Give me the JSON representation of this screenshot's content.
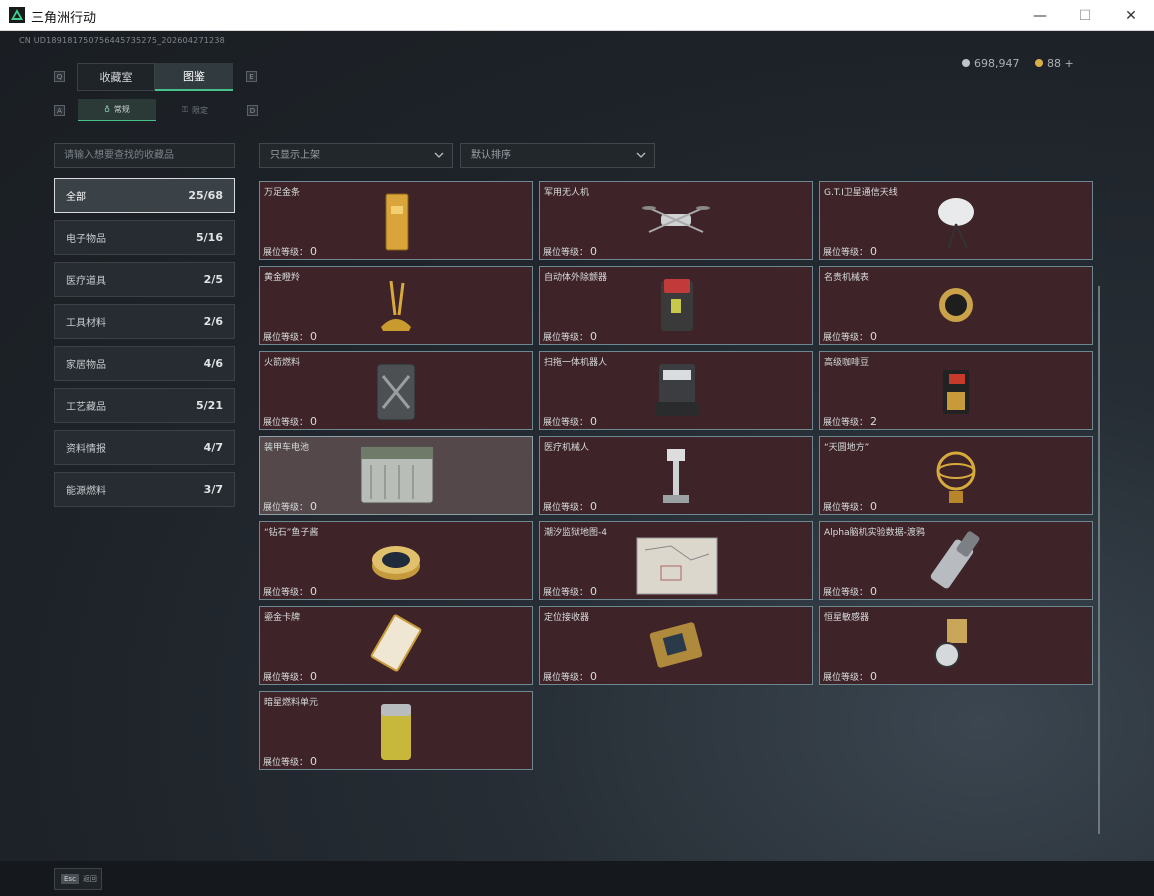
{
  "window": {
    "title": "三角洲行动",
    "minimize": "—",
    "maximize": "☐",
    "close": "✕"
  },
  "header": {
    "uid": "CN UD189181750756445735275_202604271238",
    "currency": [
      {
        "icon": "silver-coin-icon",
        "value": "698,947"
      },
      {
        "icon": "gold-coin-icon",
        "value": "88 +"
      }
    ]
  },
  "tabs": [
    {
      "label": "收藏室",
      "key_left": "Q",
      "active": false
    },
    {
      "label": "图鉴",
      "key_right": "E",
      "active": true
    }
  ],
  "subtabs": [
    {
      "label": "常规",
      "key_left": "A",
      "active": true
    },
    {
      "label": "限定",
      "key_right": "D",
      "active": false
    }
  ],
  "search": {
    "placeholder": "请输入想要查找的收藏品"
  },
  "filters": {
    "shelf_filter": "只显示上架",
    "sort": "默认排序"
  },
  "categories": [
    {
      "label": "全部",
      "count": "25/68",
      "active": true
    },
    {
      "label": "电子物品",
      "count": "5/16"
    },
    {
      "label": "医疗道具",
      "count": "2/5"
    },
    {
      "label": "工具材料",
      "count": "2/6"
    },
    {
      "label": "家居物品",
      "count": "4/6"
    },
    {
      "label": "工艺藏品",
      "count": "5/21"
    },
    {
      "label": "资料情报",
      "count": "4/7"
    },
    {
      "label": "能源燃料",
      "count": "3/7"
    }
  ],
  "level_label": "展位等级：",
  "items": [
    {
      "name": "",
      "level": "0",
      "icon": "dark-panel-icon"
    },
    {
      "name": "",
      "level": "0",
      "icon": "circuit-case-icon"
    },
    {
      "name": "",
      "level": "0",
      "icon": "bottle-icon"
    },
    {
      "name": "万足金条",
      "level": "0",
      "icon": "gold-bar-icon"
    },
    {
      "name": "军用无人机",
      "level": "0",
      "icon": "drone-icon"
    },
    {
      "name": "G.T.I卫星通信天线",
      "level": "0",
      "icon": "satellite-dish-icon"
    },
    {
      "name": "黄金瞪羚",
      "level": "0",
      "icon": "golden-gazelle-icon"
    },
    {
      "name": "自动体外除颤器",
      "level": "0",
      "icon": "defibrillator-icon"
    },
    {
      "name": "名贵机械表",
      "level": "0",
      "icon": "watch-icon"
    },
    {
      "name": "火箭燃料",
      "level": "0",
      "icon": "fuel-canister-icon"
    },
    {
      "name": "扫拖一体机器人",
      "level": "0",
      "icon": "robot-vacuum-icon"
    },
    {
      "name": "高级咖啡豆",
      "level": "2",
      "icon": "coffee-bag-icon"
    },
    {
      "name": "装甲车电池",
      "level": "0",
      "icon": "battery-icon",
      "hover": true
    },
    {
      "name": "医疗机械人",
      "level": "0",
      "icon": "medical-robot-icon"
    },
    {
      "name": "“天圆地方”",
      "level": "0",
      "icon": "armillary-sphere-icon"
    },
    {
      "name": "“钻石”鱼子酱",
      "level": "0",
      "icon": "caviar-tin-icon"
    },
    {
      "name": "潮汐监狱地图-4",
      "level": "0",
      "icon": "map-icon"
    },
    {
      "name": "Alpha脑机实验数据-渡鸦",
      "level": "0",
      "icon": "data-device-icon"
    },
    {
      "name": "鎏金卡牌",
      "level": "0",
      "icon": "gilded-card-icon"
    },
    {
      "name": "定位接收器",
      "level": "0",
      "icon": "locator-receiver-icon"
    },
    {
      "name": "恒星敏感器",
      "level": "0",
      "icon": "star-sensor-icon"
    },
    {
      "name": "暗星燃料单元",
      "level": "0",
      "icon": "fuel-cell-icon"
    }
  ],
  "footer": {
    "esc_key": "Esc",
    "back_label": "返回"
  }
}
